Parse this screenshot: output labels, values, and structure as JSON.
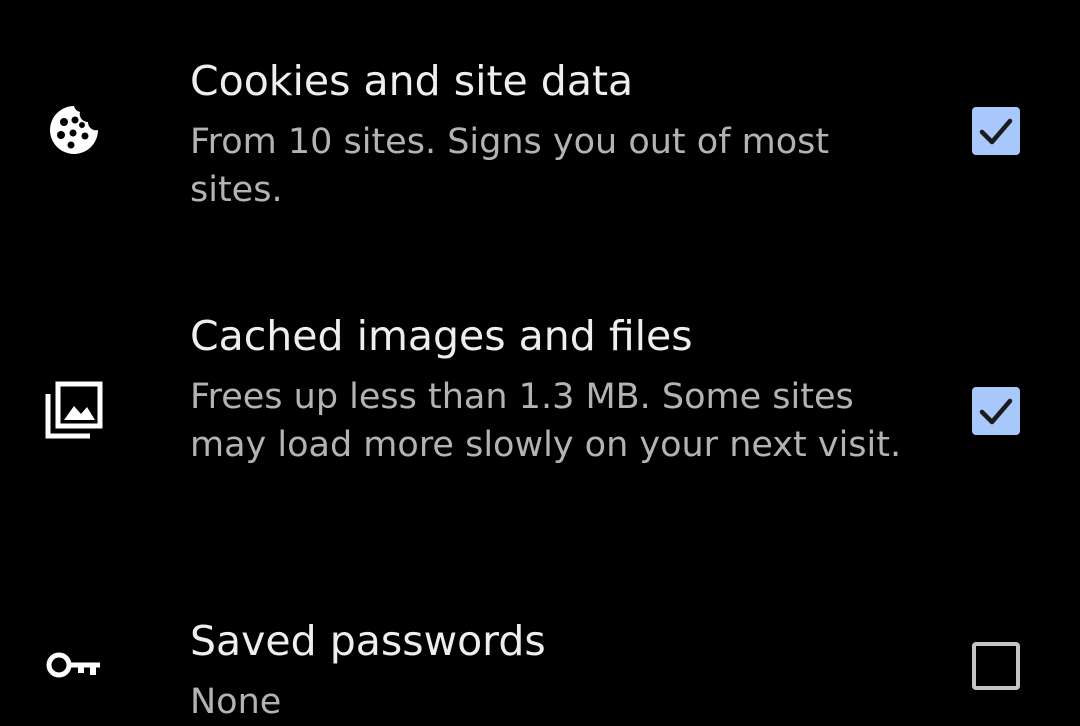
{
  "items": [
    {
      "title": "Cookies and site data",
      "description": "From 10 sites. Signs you out of most sites.",
      "icon": "cookie-icon",
      "checked": true
    },
    {
      "title": "Cached images and files",
      "description": "Frees up less than 1.3 MB. Some sites may load more slowly on your next visit.",
      "icon": "image-stack-icon",
      "checked": true
    },
    {
      "title": "Saved passwords",
      "description": "None",
      "icon": "key-icon",
      "checked": false
    }
  ],
  "colors": {
    "background": "#000000",
    "title": "#eeeeee",
    "description": "#b3b3b3",
    "checkbox_checked": "#a8c7fa",
    "checkmark": "#1b1b1f",
    "checkbox_unchecked_border": "#c4c4c4"
  }
}
